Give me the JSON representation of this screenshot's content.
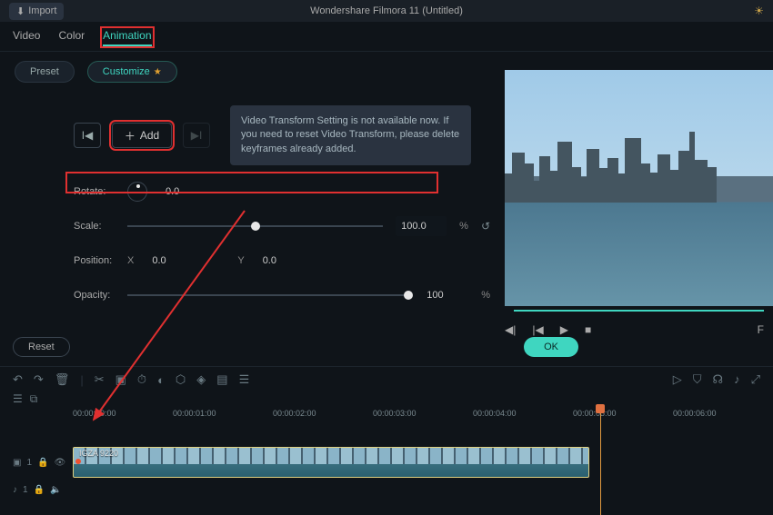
{
  "titlebar": {
    "import": "Import",
    "title": "Wondershare Filmora 11 (Untitled)"
  },
  "tabs": {
    "video": "Video",
    "color": "Color",
    "animation": "Animation"
  },
  "subtabs": {
    "preset": "Preset",
    "customize": "Customize"
  },
  "controls": {
    "add": "Add",
    "tooltip": "Video Transform Setting is not available now. If you need to reset Video Transform, please delete keyframes already added."
  },
  "props": {
    "rotate_label": "Rotate:",
    "rotate_value": "0.0",
    "scale_label": "Scale:",
    "scale_value": "100.0",
    "scale_unit": "%",
    "position_label": "Position:",
    "pos_x_label": "X",
    "pos_x_value": "0.0",
    "pos_y_label": "Y",
    "pos_y_value": "0.0",
    "opacity_label": "Opacity:",
    "opacity_value": "100",
    "opacity_unit": "%"
  },
  "actions": {
    "reset": "Reset",
    "ok": "OK"
  },
  "play": {
    "fullscreen": "F"
  },
  "timeline": {
    "ticks": [
      "00:00:00:00",
      "00:00:01:00",
      "00:00:02:00",
      "00:00:03:00",
      "00:00:04:00",
      "00:00:05:00",
      "00:00:06:00"
    ],
    "clip_label": "IGZA 9220",
    "track1": "1",
    "audio_track": "1"
  }
}
